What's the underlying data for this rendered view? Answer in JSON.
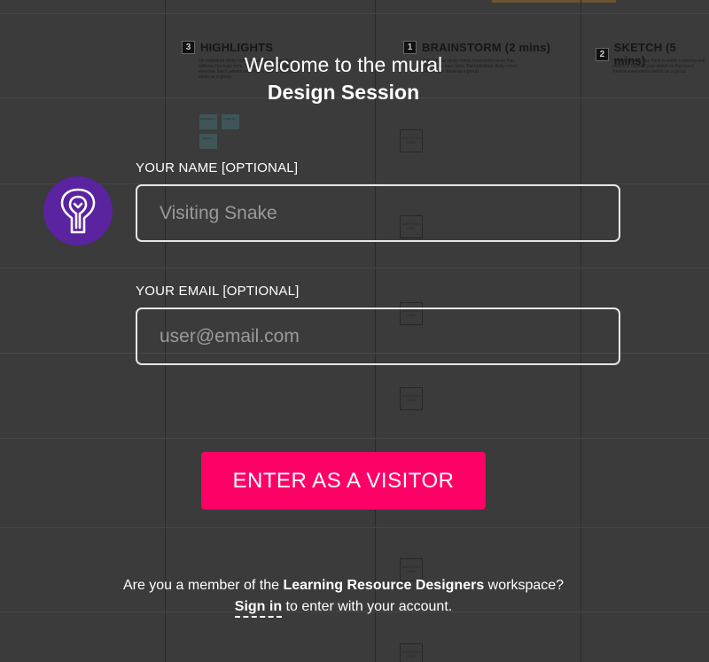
{
  "background": {
    "columns": [
      {
        "num": "3",
        "title": "HIGHLIGHTS",
        "desc": "On individual sticky notes, brainstorm ideas that address the topic here. This is a quiet individual exercise. Each person who has a card ... then mark ideas as a group."
      },
      {
        "num": "1",
        "title": "BRAINSTORM (2 mins)",
        "desc": "On individual sticky notes, brainstorm ideas that address the topic here. Put individual sticky notes. Then review ideas as a group."
      },
      {
        "num": "2",
        "title": "SKETCH (5 mins)",
        "desc": "Select the idea you think is worth exploring and sketch it. Upload your sketch to the mural. Review everyone's sketch as a group."
      }
    ],
    "stickies": [
      "Sent ideas to ...",
      "Posted on ...",
      "Ideas to ..."
    ],
    "photo_placeholder": "ADD PHOTO HERE"
  },
  "form": {
    "welcome": "Welcome to the mural",
    "session_name": "Design Session",
    "name_label": "YOUR NAME [OPTIONAL]",
    "name_placeholder": "Visiting Snake",
    "email_label": "YOUR EMAIL [OPTIONAL]",
    "email_placeholder": "user@email.com",
    "enter_button": "ENTER AS A VISITOR",
    "member_prefix": "Are you a member of the ",
    "workspace_name": "Learning Resource Designers",
    "member_suffix": " workspace?",
    "signin_link": "Sign in",
    "signin_suffix": " to enter with your account."
  },
  "colors": {
    "accent": "#ff0066",
    "avatar_bg": "#5a23a0"
  },
  "icons": {
    "avatar": "snake-icon"
  }
}
